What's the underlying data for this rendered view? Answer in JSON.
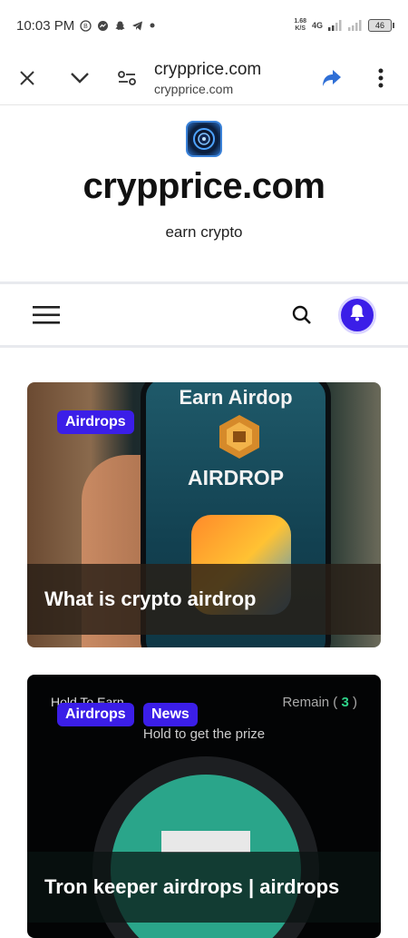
{
  "status_bar": {
    "time": "10:03 PM",
    "net_speed_value": "1.68",
    "net_speed_unit": "K/S",
    "net_type": "4G",
    "battery": "46"
  },
  "browser": {
    "page_title": "crypprice.com",
    "url": "crypprice.com"
  },
  "site": {
    "title": "crypprice.com",
    "tagline": "earn crypto"
  },
  "colors": {
    "accent": "#3b1ee8",
    "share_blue": "#2f6fd6"
  },
  "posts": [
    {
      "badges": [
        "Airdrops"
      ],
      "title": "What is crypto airdrop",
      "image_text": {
        "top": "Earn Airdop",
        "middle": "AIRDROP"
      }
    },
    {
      "badges": [
        "Airdrops",
        "News"
      ],
      "title": "Tron keeper airdrops | airdrops",
      "image_text": {
        "hold": "Hold To Earn",
        "remain_label": "Remain (",
        "remain_count": "3",
        "remain_close": ")",
        "subtitle": "Hold to get the prize"
      }
    }
  ]
}
